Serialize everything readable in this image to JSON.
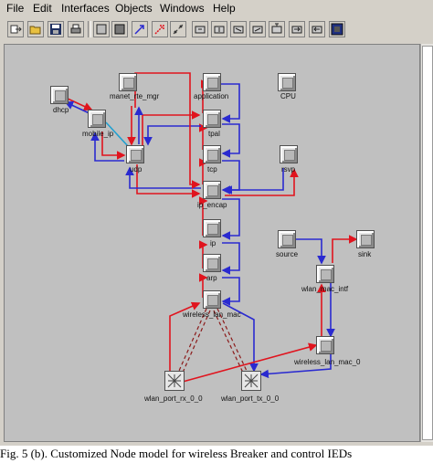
{
  "menu": [
    "File",
    "Edit",
    "Interfaces",
    "Objects",
    "Windows",
    "Help"
  ],
  "toolbar_icons": [
    "export-icon",
    "open-folder-icon",
    "save-icon",
    "print-icon",
    "fixed-node-icon",
    "module-icon",
    "packet-stream-icon",
    "statwire-icon",
    "logical-tap-icon",
    "transmitter-icon",
    "receiver-icon",
    "radio-transmitter-icon",
    "radio-receiver-icon",
    "antenna-icon",
    "bus-transmitter-icon",
    "bus-receiver-icon",
    "processor-icon"
  ],
  "nodes": {
    "dhcp": "dhcp",
    "manet": "manet_rte_mgr",
    "application": "application",
    "cpu": "CPU",
    "mobile_ip": "mobile_ip",
    "tpal": "tpal",
    "udp": "udp",
    "tcp": "tcp",
    "rsvp": "rsvp",
    "ip_encap": "ip_encap",
    "ip": "ip",
    "source": "source",
    "sink": "sink",
    "arp": "arp",
    "wlan_mac_intf": "wlan_mac_intf",
    "wireless_lan_mac": "wireless_lan_mac",
    "wireless_lan_mac_0": "wireless_lan_mac_0",
    "wlan_port_rx": "wlan_port_rx_0_0",
    "wlan_port_tx": "wlan_port_tx_0_0"
  },
  "colors": {
    "stream_up": "#e0141e",
    "stream_down": "#2a2ad0",
    "statwire": "#8b1a1a"
  },
  "caption": "Fig. 5 (b). Customized Node model for wireless Breaker and control IEDs"
}
